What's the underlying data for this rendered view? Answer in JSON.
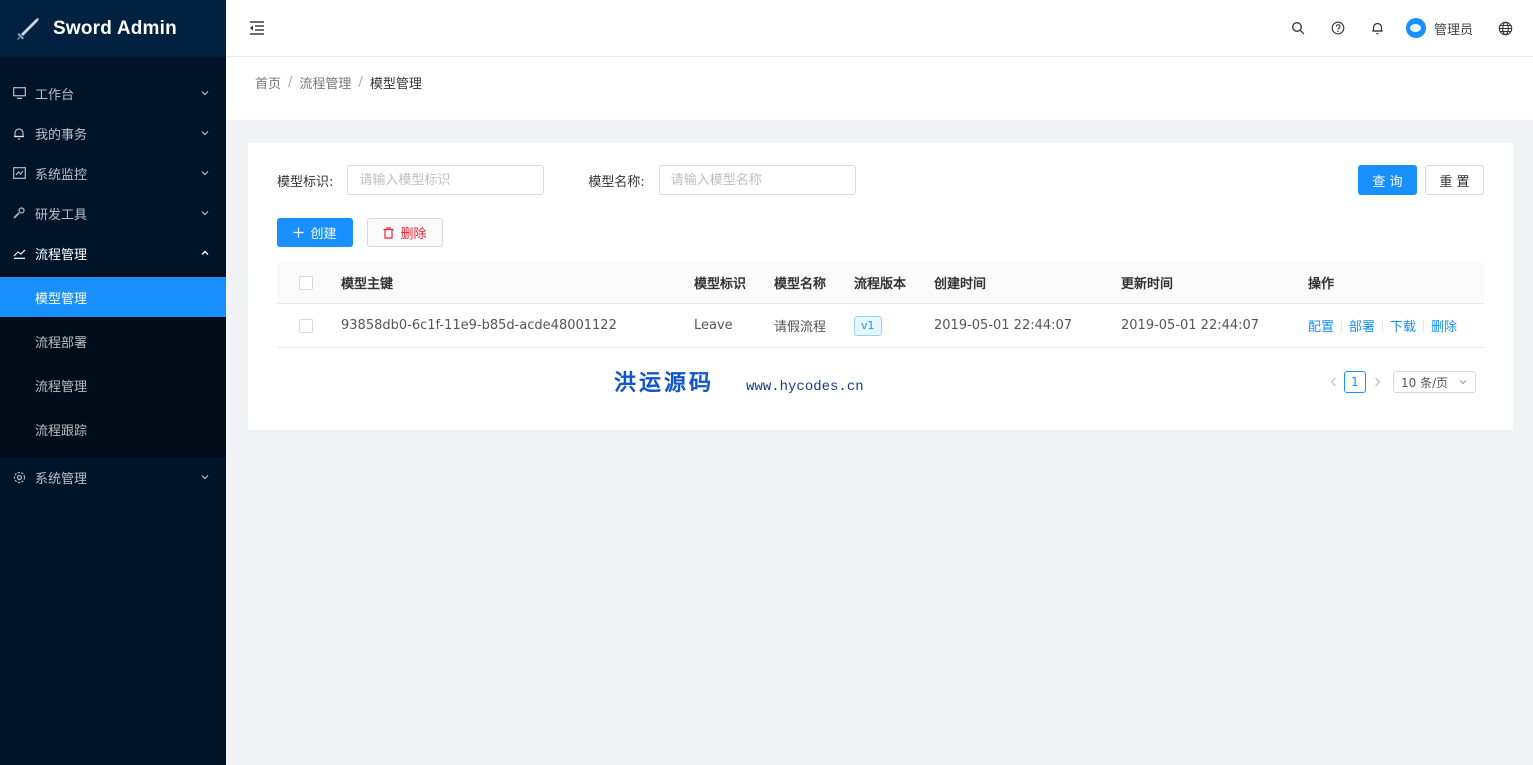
{
  "app": {
    "title": "Sword Admin"
  },
  "sidebar": {
    "items": [
      {
        "label": "工作台",
        "icon": "desktop-icon"
      },
      {
        "label": "我的事务",
        "icon": "bell-icon"
      },
      {
        "label": "系统监控",
        "icon": "monitor-chart-icon"
      },
      {
        "label": "研发工具",
        "icon": "tool-icon"
      },
      {
        "label": "流程管理",
        "icon": "line-chart-icon",
        "open": true
      },
      {
        "label": "系统管理",
        "icon": "gear-icon"
      }
    ],
    "submenu": [
      {
        "label": "模型管理",
        "active": true
      },
      {
        "label": "流程部署"
      },
      {
        "label": "流程管理"
      },
      {
        "label": "流程跟踪"
      }
    ]
  },
  "header": {
    "user_name": "管理员",
    "icons": [
      "search-icon",
      "question-icon",
      "bell-icon",
      "globe-icon"
    ]
  },
  "breadcrumb": [
    "首页",
    "流程管理",
    "模型管理"
  ],
  "search": {
    "model_key_label": "模型标识:",
    "model_key_placeholder": "请输入模型标识",
    "model_key_value": "",
    "model_name_label": "模型名称:",
    "model_name_placeholder": "请输入模型名称",
    "model_name_value": "",
    "query_label": "查 询",
    "reset_label": "重 置"
  },
  "actions": {
    "create_label": "创建",
    "delete_label": "删除"
  },
  "table": {
    "columns": [
      "模型主键",
      "模型标识",
      "模型名称",
      "流程版本",
      "创建时间",
      "更新时间",
      "操作"
    ],
    "rows": [
      {
        "id": "93858db0-6c1f-11e9-b85d-acde48001122",
        "key": "Leave",
        "name": "请假流程",
        "version": "v1",
        "created": "2019-05-01 22:44:07",
        "updated": "2019-05-01 22:44:07",
        "ops": [
          "配置",
          "部署",
          "下载",
          "删除"
        ]
      }
    ]
  },
  "watermark": {
    "cn": "洪运源码",
    "url": "www.hycodes.cn"
  },
  "pagination": {
    "current": "1",
    "page_size": "10 条/页"
  },
  "colors": {
    "primary": "#1890ff",
    "sidebar_bg": "#001529",
    "danger": "#f5222d"
  }
}
